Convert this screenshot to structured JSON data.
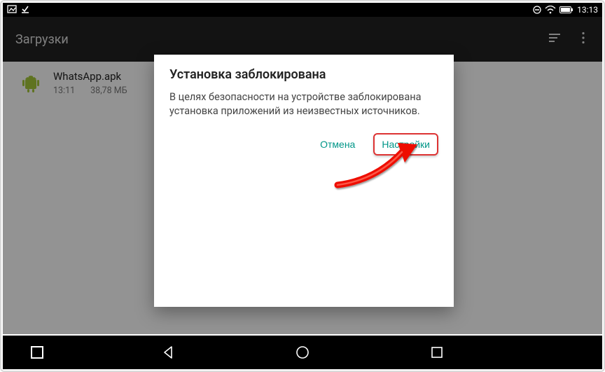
{
  "statusbar": {
    "time": "13:13"
  },
  "toolbar": {
    "title": "Загрузки"
  },
  "file": {
    "name": "WhatsApp.apk",
    "time": "13:11",
    "size": "38,78 МБ"
  },
  "dialog": {
    "title": "Установка заблокирована",
    "message": "В целях безопасности на устройстве заблокирована установка приложений из неизвестных источников.",
    "cancel": "Отмена",
    "settings": "Настройки"
  }
}
